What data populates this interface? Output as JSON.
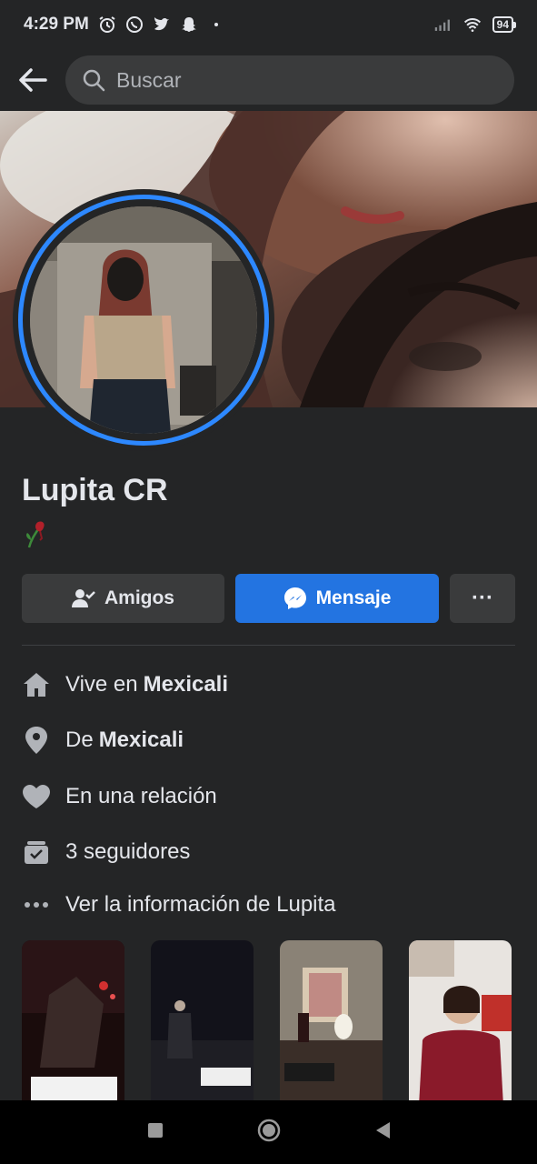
{
  "status_bar": {
    "time": "4:29 PM",
    "battery": "94",
    "left_icons": [
      "alarm-icon",
      "whatsapp-icon",
      "twitter-icon",
      "snapchat-icon",
      "dot-icon"
    ],
    "right_icons": [
      "signal-icon",
      "wifi-icon",
      "battery-icon"
    ]
  },
  "topbar": {
    "search_placeholder": "Buscar"
  },
  "profile": {
    "name": "Lupita CR",
    "emoji": "🥀"
  },
  "actions": {
    "friends_label": "Amigos",
    "message_label": "Mensaje",
    "more_label": "···"
  },
  "info": {
    "lives_prefix": "Vive en",
    "lives_city": "Mexicali",
    "from_prefix": "De",
    "from_city": "Mexicali",
    "relationship": "En una relación",
    "followers": "3 seguidores",
    "see_info": "Ver la información de Lupita"
  },
  "colors": {
    "accent": "#2374e1",
    "ring": "#2d88ff",
    "surface": "#242526",
    "button": "#3a3b3c"
  }
}
